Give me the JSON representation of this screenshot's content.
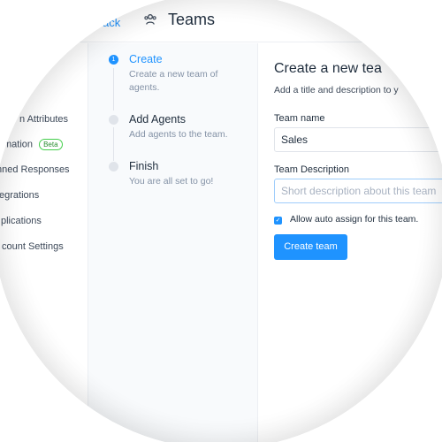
{
  "header": {
    "back_label": "ack",
    "title": "Teams",
    "icon": "people-group-icon"
  },
  "sidebar": {
    "items": [
      {
        "label": "n Attributes"
      },
      {
        "label": "mation",
        "badge": "Beta"
      },
      {
        "label": "nned Responses"
      },
      {
        "label": "egrations"
      },
      {
        "label": "plications"
      },
      {
        "label": "count Settings"
      }
    ]
  },
  "steps": [
    {
      "number": "1",
      "title": "Create",
      "description": "Create a new team of agents."
    },
    {
      "title": "Add Agents",
      "description": "Add agents to the team."
    },
    {
      "title": "Finish",
      "description": "You are all set to go!"
    }
  ],
  "form": {
    "title": "Create a new tea",
    "subtitle": "Add a title and description to y",
    "team_name_label": "Team name",
    "team_name_value": "Sales",
    "description_label": "Team Description",
    "description_placeholder": "Short description about this team",
    "auto_assign_label": "Allow auto assign for this team.",
    "auto_assign_checked": true,
    "submit_label": "Create team"
  },
  "colors": {
    "accent": "#1f93ff",
    "text": "#1f2d3d",
    "muted": "#8492a6",
    "beta_green": "#44ce4b"
  }
}
